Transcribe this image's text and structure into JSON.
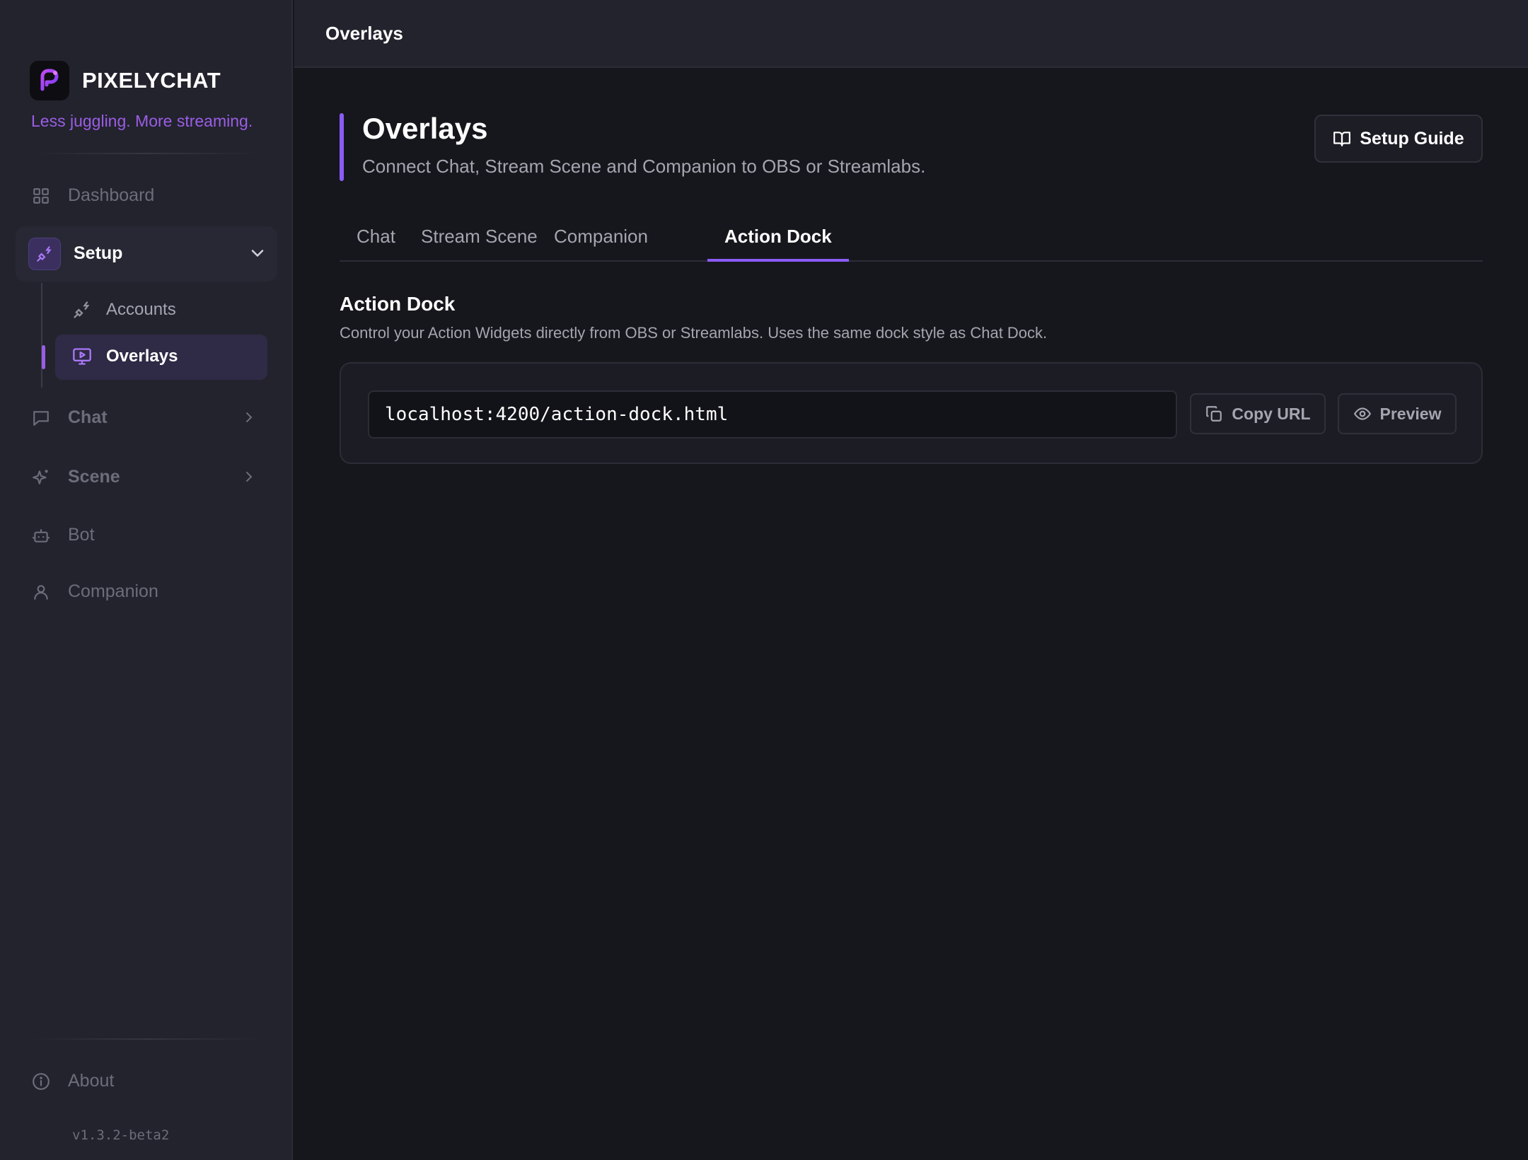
{
  "app": {
    "name": "PIXELYCHAT",
    "tagline": "Less juggling. More streaming.",
    "version": "v1.3.2-beta2",
    "accent_color": "#8a5cf6"
  },
  "sidebar": {
    "items": [
      {
        "label": "Dashboard",
        "icon": "grid-icon"
      },
      {
        "label": "Setup",
        "icon": "plug-icon",
        "expanded": true,
        "children": [
          {
            "label": "Accounts",
            "icon": "plug-icon"
          },
          {
            "label": "Overlays",
            "icon": "monitor-play-icon",
            "active": true
          }
        ]
      },
      {
        "label": "Chat",
        "icon": "chat-bubble-icon"
      },
      {
        "label": "Scene",
        "icon": "sparkles-icon"
      },
      {
        "label": "Bot",
        "icon": "robot-icon"
      },
      {
        "label": "Companion",
        "icon": "user-icon"
      }
    ],
    "footer": {
      "about_label": "About",
      "about_icon": "info-icon"
    }
  },
  "topbar": {
    "title": "Overlays"
  },
  "page": {
    "title": "Overlays",
    "subtitle": "Connect Chat, Stream Scene and Companion to OBS or Streamlabs.",
    "guide_button": "Setup Guide"
  },
  "tabs": [
    {
      "label": "Chat"
    },
    {
      "label": "Stream Scene"
    },
    {
      "label": "Companion"
    },
    {
      "label": "Action Dock",
      "active": true
    }
  ],
  "section": {
    "title": "Action Dock",
    "description": "Control your Action Widgets directly from OBS or Streamlabs. Uses the same dock style as Chat Dock.",
    "url": "localhost:4200/action-dock.html",
    "copy_label": "Copy URL",
    "preview_label": "Preview"
  }
}
